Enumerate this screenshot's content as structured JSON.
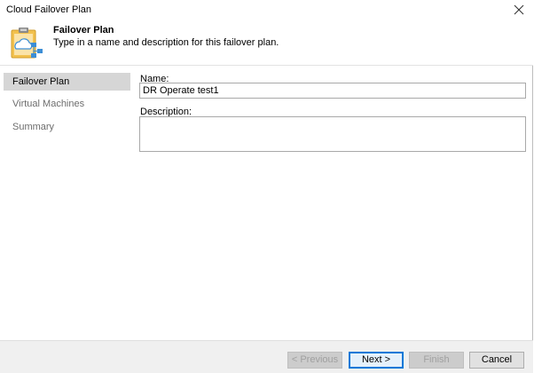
{
  "window": {
    "title": "Cloud Failover Plan"
  },
  "header": {
    "title": "Failover Plan",
    "description": "Type in a name and description for this failover plan."
  },
  "sidebar": {
    "items": [
      {
        "label": "Failover Plan",
        "active": true
      },
      {
        "label": "Virtual Machines",
        "active": false
      },
      {
        "label": "Summary",
        "active": false
      }
    ]
  },
  "form": {
    "name_label": "Name:",
    "name_value": "DR Operate test1",
    "description_label": "Description:",
    "description_value": ""
  },
  "footer": {
    "previous_label": "< Previous",
    "next_label": "Next >",
    "finish_label": "Finish",
    "cancel_label": "Cancel"
  },
  "colors": {
    "active_item_bg": "#d6d6d6",
    "inactive_item_text": "#6d6d6d",
    "accent": "#0078d7",
    "icon_clipboard": "#f2c14e",
    "icon_cloud": "#3c8ed6"
  },
  "icons": {
    "close": "close-icon",
    "header": "failover-plan-icon"
  }
}
